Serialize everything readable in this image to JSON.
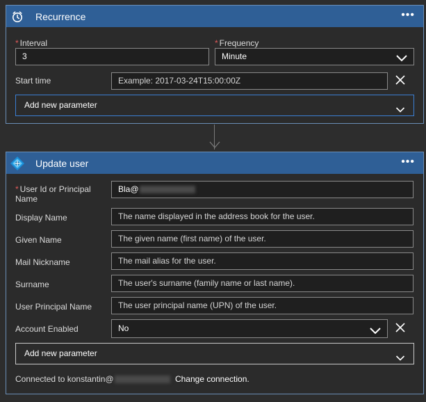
{
  "recurrence": {
    "title": "Recurrence",
    "more_label": "•••",
    "icon": "alarm-clock-icon",
    "interval": {
      "label": "Interval",
      "value": "3"
    },
    "frequency": {
      "label": "Frequency",
      "value": "Minute"
    },
    "start_time": {
      "label": "Start time",
      "placeholder": "Example: 2017-03-24T15:00:00Z"
    },
    "add_param_label": "Add new parameter"
  },
  "update_user": {
    "title": "Update user",
    "more_label": "•••",
    "icon": "azure-ad-icon",
    "fields": {
      "user_id": {
        "label": "User Id or Principal Name",
        "value": "Bla@"
      },
      "display_name": {
        "label": "Display Name",
        "placeholder": "The name displayed in the address book for the user."
      },
      "given_name": {
        "label": "Given Name",
        "placeholder": "The given name (first name) of the user."
      },
      "mail_nickname": {
        "label": "Mail Nickname",
        "placeholder": "The mail alias for the user."
      },
      "surname": {
        "label": "Surname",
        "placeholder": "The user's surname (family name or last name)."
      },
      "upn": {
        "label": "User Principal Name",
        "placeholder": "The user principal name (UPN) of the user."
      },
      "account_enabled": {
        "label": "Account Enabled",
        "value": "No"
      }
    },
    "add_param_label": "Add new parameter",
    "connection_prefix": "Connected to konstantin@",
    "change_connection_label": "Change connection."
  },
  "colors": {
    "header_blue": "#2f5f96",
    "card_border": "#6b8fb8",
    "required_red": "#e05a5a",
    "focus_blue": "#3b7fd4",
    "background": "#2d2d2d"
  }
}
